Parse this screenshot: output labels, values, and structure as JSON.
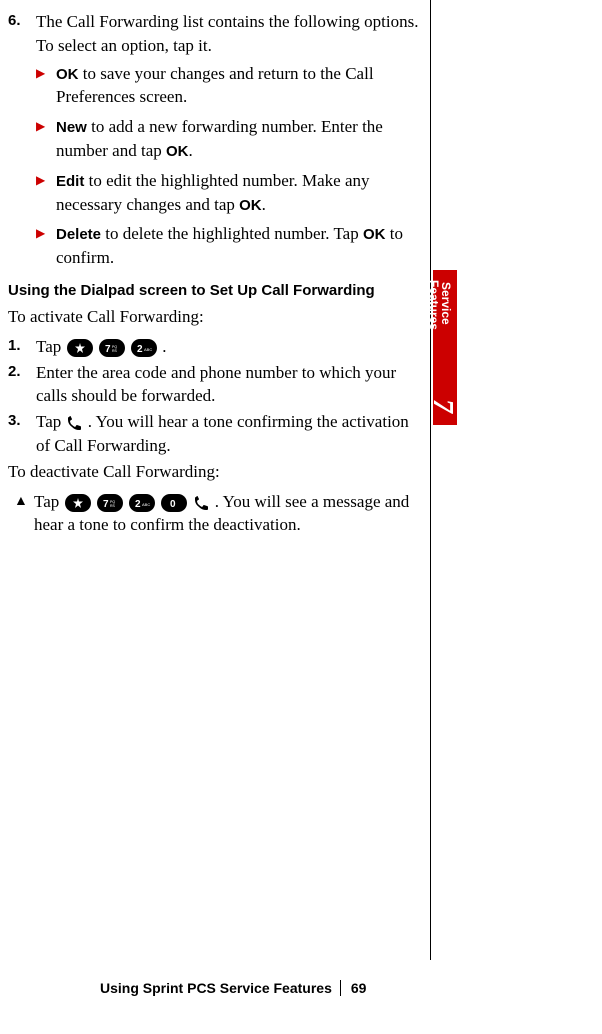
{
  "step6": {
    "num": "6.",
    "text1": "The Call Forwarding list contains the following options. To select an option, tap it.",
    "options": [
      {
        "label": "OK",
        "text": " to save your changes and return to the Call Preferences screen."
      },
      {
        "label": "New",
        "text_pre": " to add a new forwarding number. Enter the number and tap ",
        "ok": "OK",
        "text_post": "."
      },
      {
        "label": "Edit",
        "text_pre": " to edit the highlighted number. Make any necessary changes and tap ",
        "ok": "OK",
        "text_post": "."
      },
      {
        "label": "Delete",
        "text_pre": " to delete the highlighted number. Tap ",
        "ok": "OK",
        "text_post": " to confirm."
      }
    ]
  },
  "heading": "Using the Dialpad screen to Set Up Call Forwarding",
  "activate_intro": "To activate Call Forwarding:",
  "steps": [
    {
      "num": "1.",
      "text_pre": "Tap ",
      "text_post": " ."
    },
    {
      "num": "2.",
      "text": "Enter the area code and phone number to which your calls should be forwarded."
    },
    {
      "num": "3.",
      "text_pre": "Tap ",
      "text_post": " . You will hear a tone confirming the activation of Call Forwarding."
    }
  ],
  "deactivate_intro": "To deactivate Call Forwarding:",
  "deactivate_step": {
    "text_pre": "Tap ",
    "text_post": " . You will see a message and hear a tone to confirm the deactivation."
  },
  "side_tab": {
    "line1": "Service",
    "line2": "Features",
    "num": "7"
  },
  "footer": {
    "text": "Using Sprint PCS Service Features",
    "page": "69"
  }
}
